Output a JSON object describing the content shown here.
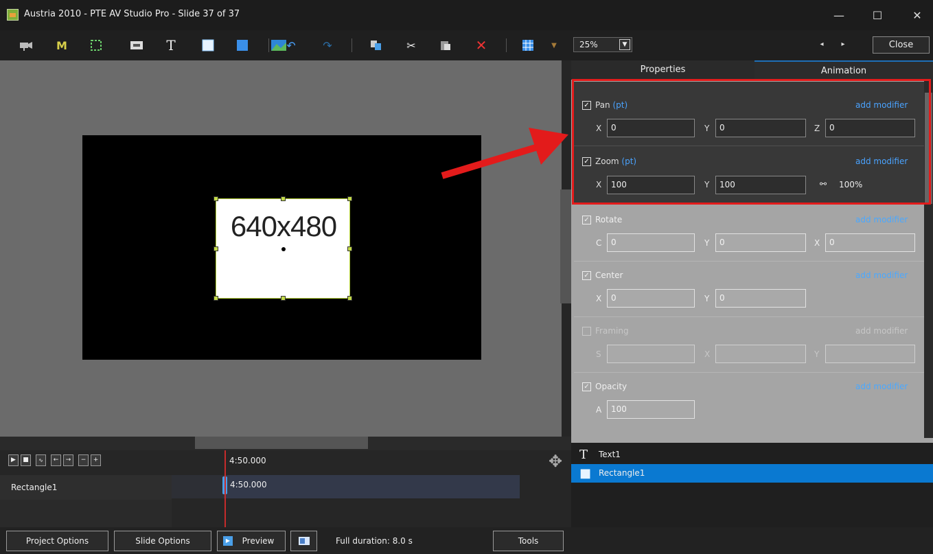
{
  "window": {
    "title": "Austria 2010 - PTE AV Studio Pro - Slide 37 of 37",
    "minimize": "—",
    "maximize": "☐",
    "close": "✕"
  },
  "toolbar": {
    "letter_m": "M",
    "letter_t": "T",
    "zoom_value": "25%",
    "prev": "◂",
    "next": "▸",
    "close_label": "Close"
  },
  "canvas": {
    "object_label": "640x480"
  },
  "tabs": {
    "properties": "Properties",
    "animation": "Animation"
  },
  "animation": {
    "add_modifier": "add modifier",
    "pan": {
      "label": "Pan",
      "unit": "(pt)",
      "x_label": "X",
      "x": "0",
      "y_label": "Y",
      "y": "0",
      "z_label": "Z",
      "z": "0"
    },
    "zoom": {
      "label": "Zoom",
      "unit": "(pt)",
      "x_label": "X",
      "x": "100",
      "y_label": "Y",
      "y": "100",
      "percent": "100%"
    },
    "rotate": {
      "label": "Rotate",
      "c_label": "C",
      "c": "0",
      "y_label": "Y",
      "y": "0",
      "x_label": "X",
      "x": "0"
    },
    "center": {
      "label": "Center",
      "x_label": "X",
      "x": "0",
      "y_label": "Y",
      "y": "0"
    },
    "framing": {
      "label": "Framing",
      "s_label": "S",
      "x_label": "X",
      "y_label": "Y"
    },
    "opacity": {
      "label": "Opacity",
      "a_label": "A",
      "a": "100"
    }
  },
  "objects": [
    {
      "icon": "T",
      "name": "Text1"
    },
    {
      "icon": "■",
      "name": "Rectangle1"
    }
  ],
  "timeline": {
    "time_top": "4:50.000",
    "track_name": "Rectangle1",
    "track_time": "4:50.000"
  },
  "bottom": {
    "project_options": "Project Options",
    "slide_options": "Slide Options",
    "preview": "Preview",
    "duration": "Full duration: 8.0 s",
    "tools": "Tools"
  },
  "colors": {
    "accent": "#0a79d1",
    "annotation": "#e31b1b",
    "link": "#4aa3ff"
  }
}
